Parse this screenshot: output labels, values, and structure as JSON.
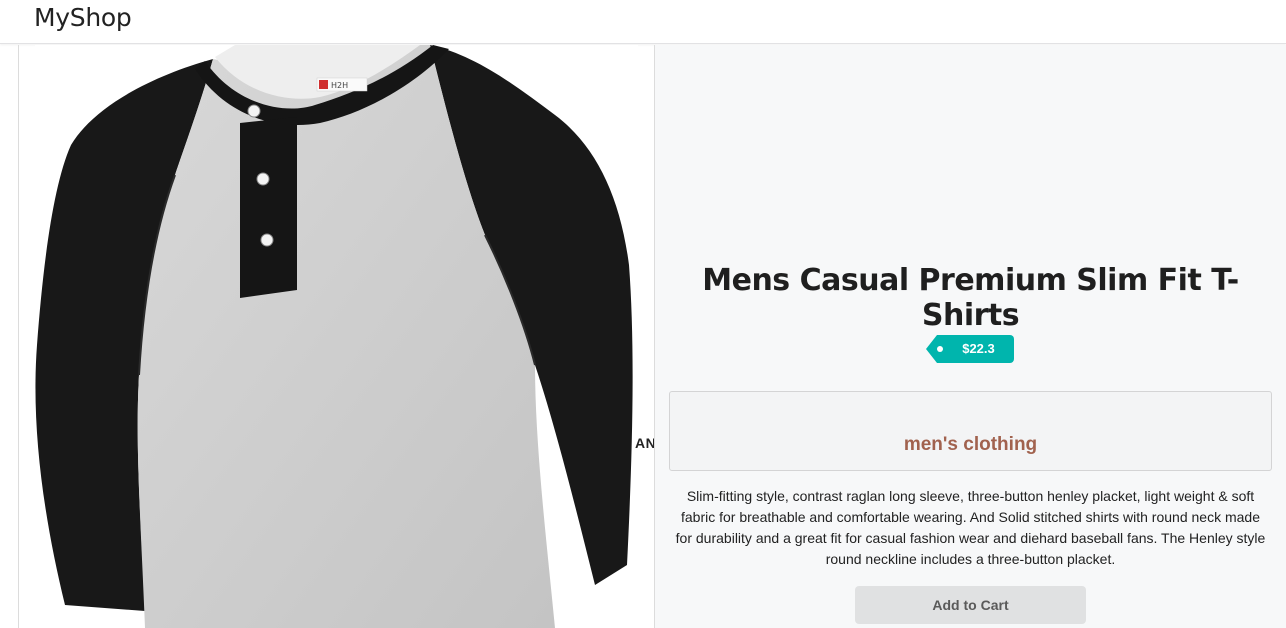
{
  "header": {
    "brand": "MyShop"
  },
  "product": {
    "image_label": "H2H",
    "divider_text": "AND",
    "title": "Mens Casual Premium Slim Fit T-Shirts",
    "price": "$22.3",
    "category": "men's clothing",
    "description": "Slim-fitting style, contrast raglan long sleeve, three-button henley placket, light weight & soft fabric for breathable and comfortable wearing. And Solid stitched shirts with round neck made for durability and a great fit for casual fashion wear and diehard baseball fans. The Henley style round neckline includes a three-button placket.",
    "add_to_cart_label": "Add to Cart"
  },
  "colors": {
    "price_tag": "#00b5ad",
    "category_text": "#a1624e",
    "button_bg": "#e0e1e2",
    "panel_bg": "#f7f8f9"
  }
}
